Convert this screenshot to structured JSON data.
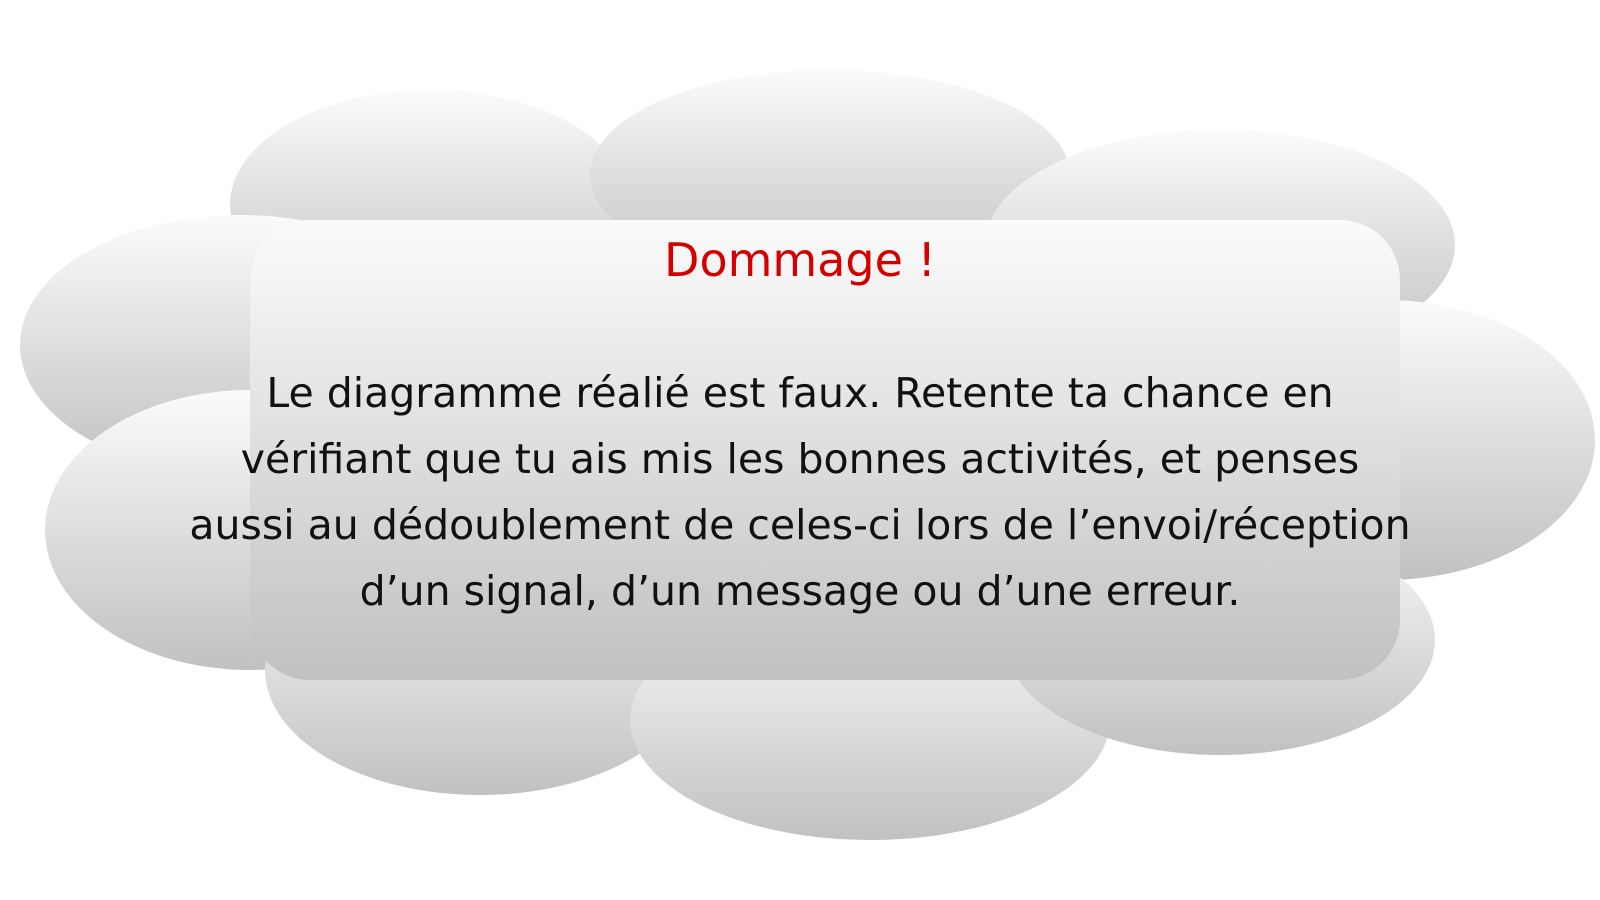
{
  "colors": {
    "title": "#d40000",
    "text": "#111111",
    "cloud_top": "#fafafa",
    "cloud_bottom": "#c2c2c2"
  },
  "dialog": {
    "title": "Dommage !",
    "lines": [
      "Le diagramme réalié est faux. Retente ta chance en",
      "vérifiant que tu ais mis les bonnes activités, et penses",
      "aussi au dédoublement de celes-ci lors de l’envoi/réception",
      "d’un signal, d’un message ou d’une erreur."
    ]
  }
}
